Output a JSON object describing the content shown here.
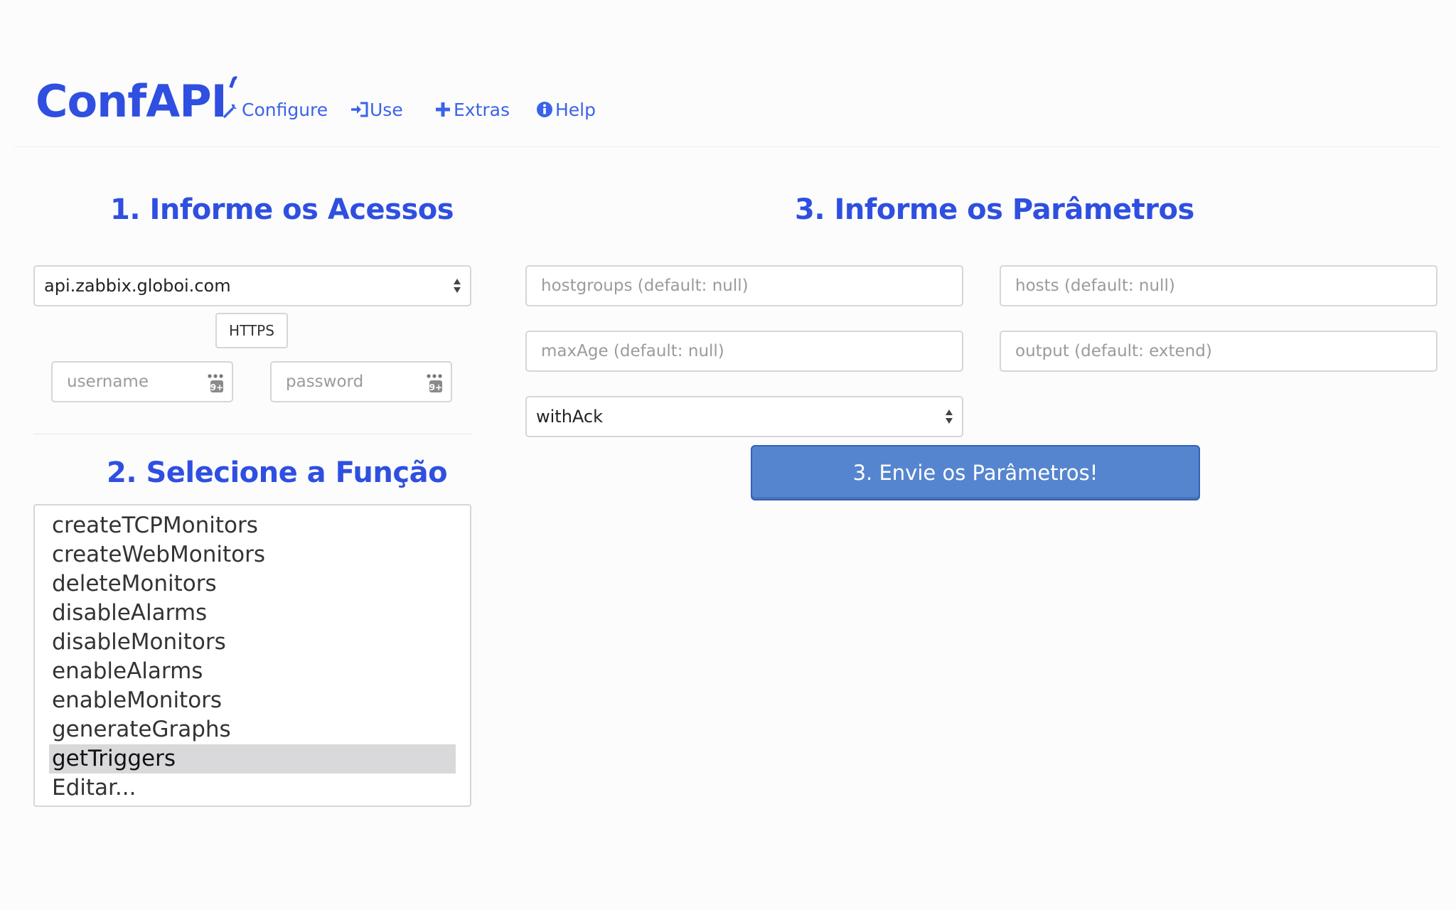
{
  "brand": {
    "name": "ConfAPI"
  },
  "nav": {
    "configure": "Configure",
    "use": "Use",
    "extras": "Extras",
    "help": "Help"
  },
  "colors": {
    "accent": "#2f4fe0",
    "link": "#3a63e8",
    "button": "#5585cf"
  },
  "access": {
    "title": "1. Informe os Acessos",
    "server_value": "api.zabbix.globoi.com",
    "https_label": "HTTPS",
    "username_placeholder": "username",
    "password_placeholder": "password"
  },
  "functions": {
    "title": "2. Selecione a Função",
    "items": [
      "createTCPMonitors",
      "createWebMonitors",
      "deleteMonitors",
      "disableAlarms",
      "disableMonitors",
      "enableAlarms",
      "enableMonitors",
      "generateGraphs",
      "getTriggers",
      "Editar..."
    ],
    "selected": "getTriggers"
  },
  "params": {
    "title": "3. Informe os Parâmetros",
    "hostgroups_placeholder": "hostgroups (default: null)",
    "hosts_placeholder": "hosts (default: null)",
    "maxage_placeholder": "maxAge (default: null)",
    "output_placeholder": "output (default: extend)",
    "withack_value": "withAck",
    "submit_label": "3. Envie os Parâmetros!"
  }
}
